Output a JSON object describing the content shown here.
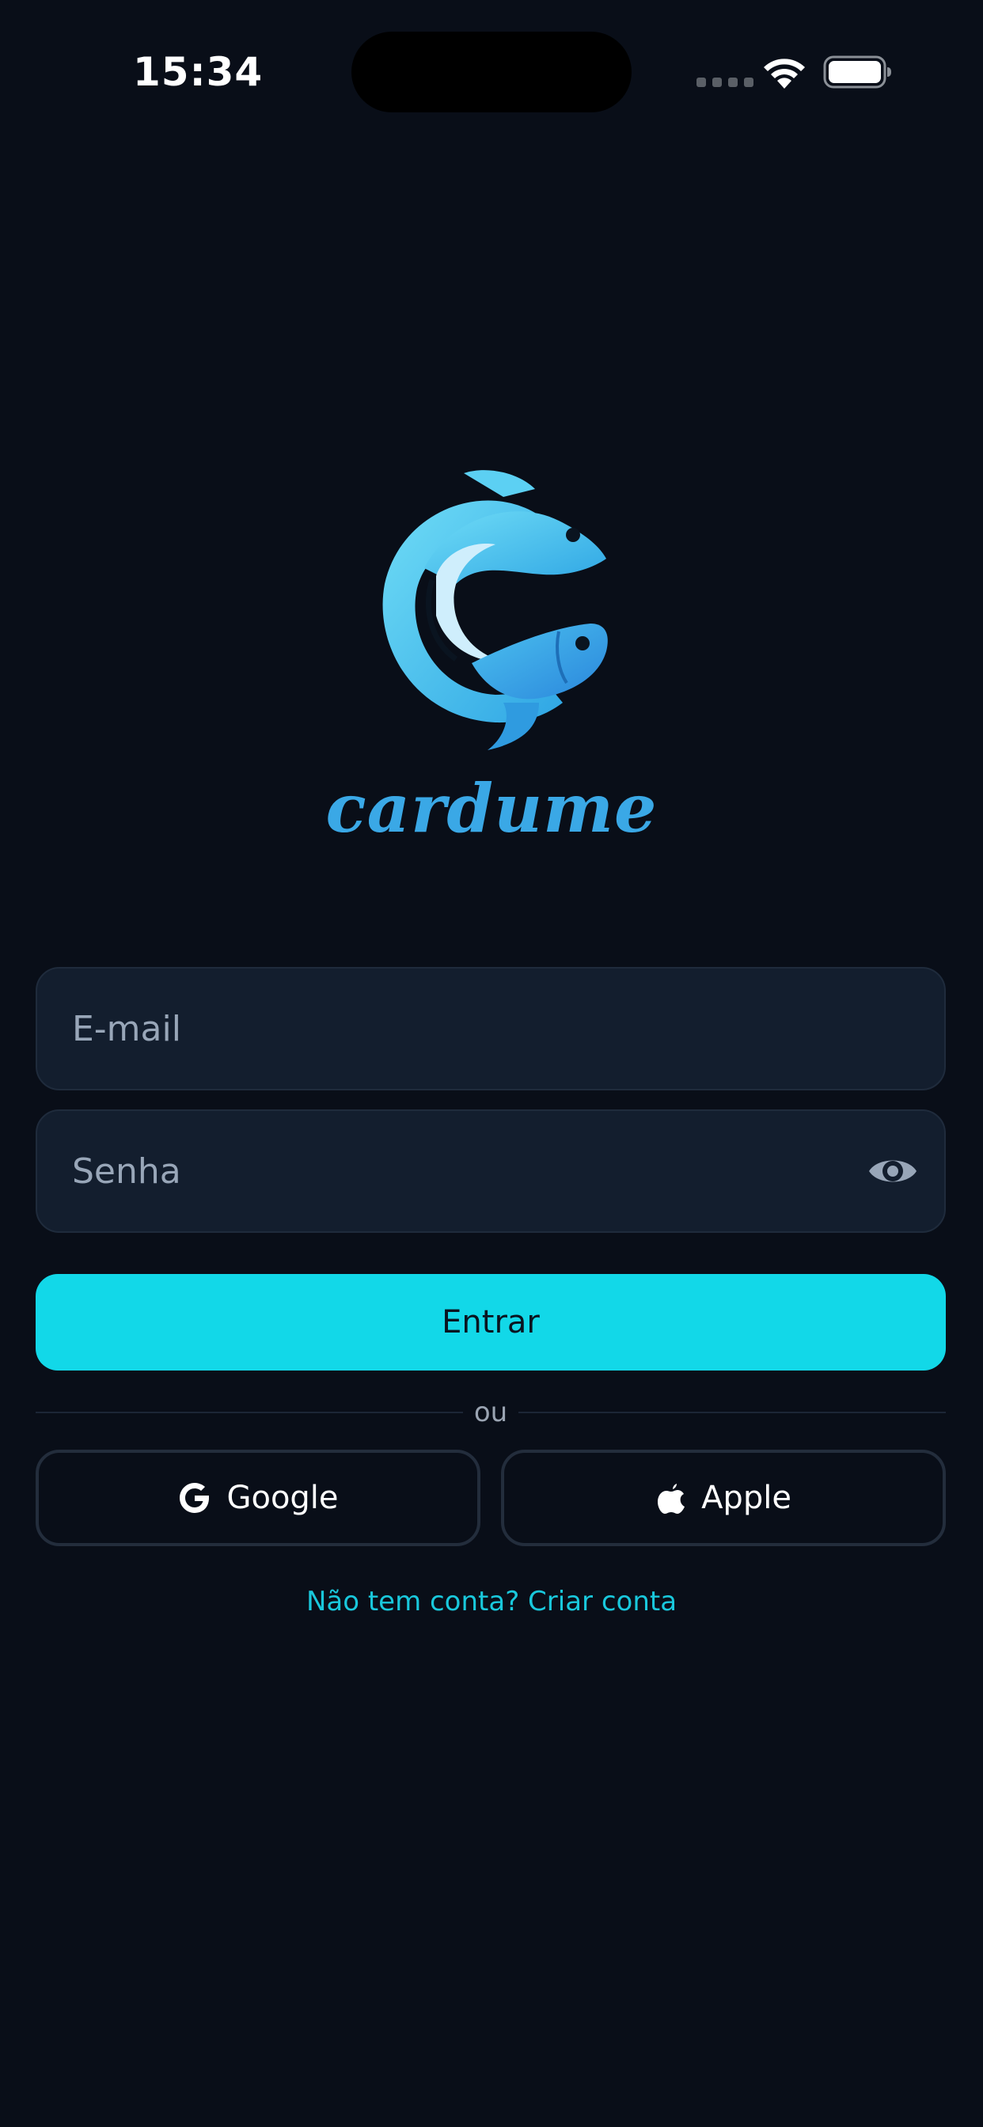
{
  "status_bar": {
    "time": "15:34",
    "icons": [
      "signal-icon",
      "wifi-icon",
      "battery-icon"
    ]
  },
  "brand": {
    "name": "cardume",
    "logo": "fish-logo-icon",
    "color": "#3aa8e6"
  },
  "form": {
    "email_placeholder": "E-mail",
    "password_placeholder": "Senha",
    "password_toggle_icon": "eye-icon",
    "submit_label": "Entrar"
  },
  "divider": {
    "label": "ou"
  },
  "social": {
    "google_label": "Google",
    "google_icon": "google-icon",
    "apple_label": "Apple",
    "apple_icon": "apple-icon"
  },
  "signup": {
    "label": "Não tem conta? Criar conta"
  },
  "colors": {
    "background": "#090e18",
    "accent": "#12d8e8",
    "field_background": "#131e2e",
    "link": "#19c8dc"
  }
}
